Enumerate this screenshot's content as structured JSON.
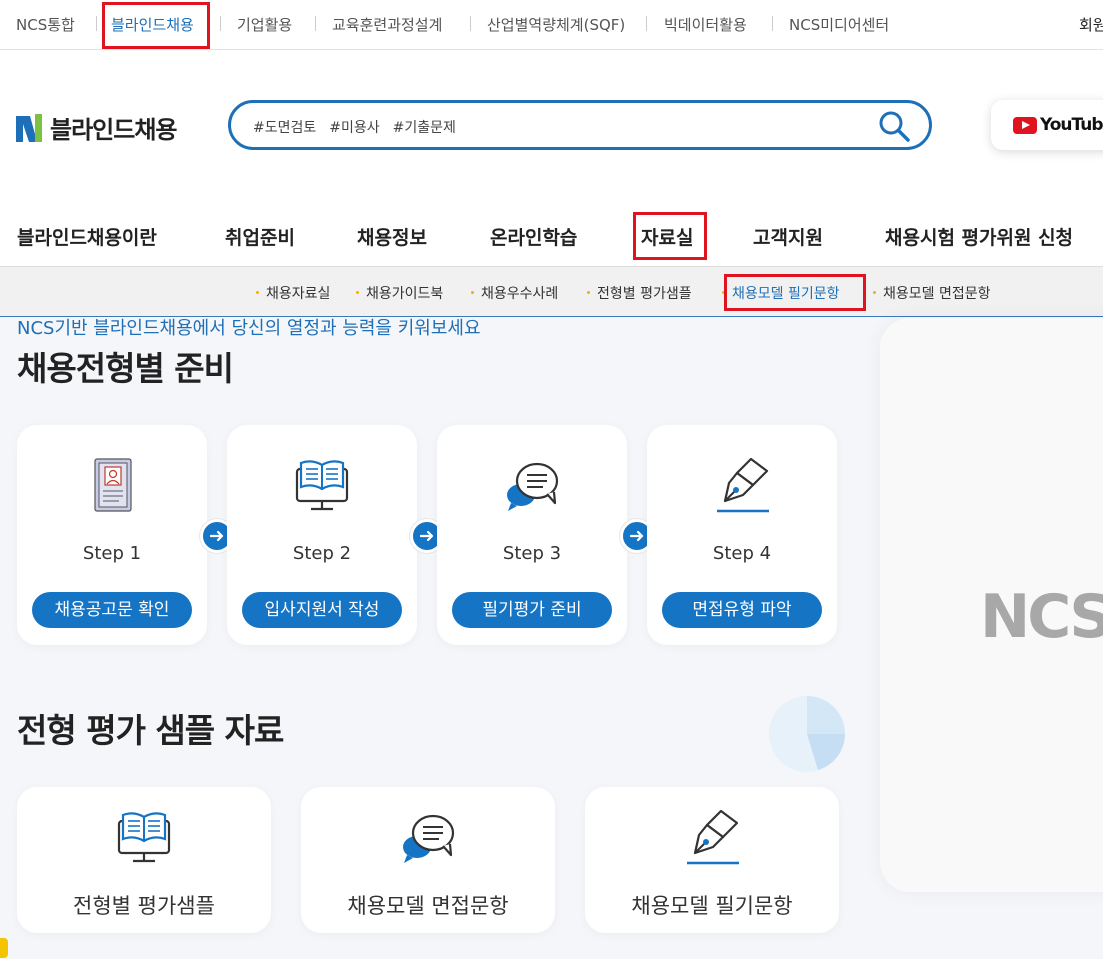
{
  "topbar": {
    "items": [
      "NCS통합",
      "블라인드채용",
      "기업활용",
      "교육훈련과정설계",
      "산업별역량체계(SQF)",
      "빅데이터활용",
      "NCS미디어센터"
    ],
    "right_link": "회원"
  },
  "header": {
    "logo_text": "블라인드채용",
    "search_tags": [
      "#도면검토",
      "#미용사",
      "#기출문제"
    ],
    "youtube_label": "YouTube"
  },
  "gnb": {
    "items": [
      "블라인드채용이란",
      "취업준비",
      "채용정보",
      "온라인학습",
      "자료실",
      "고객지원",
      "채용시험 평가위원 신청"
    ]
  },
  "subnav": {
    "items": [
      "채용자료실",
      "채용가이드북",
      "채용우수사례",
      "전형별 평가샘플",
      "채용모델 필기문항",
      "채용모델 면접문항"
    ]
  },
  "main": {
    "tagline": "NCS기반 블라인드채용에서 당신의 열정과 능력을 키워보세요",
    "section1_title": "채용전형별 준비",
    "steps": [
      {
        "label": "Step 1",
        "button": "채용공고문 확인",
        "icon": "id-card-icon"
      },
      {
        "label": "Step 2",
        "button": "입사지원서 작성",
        "icon": "book-monitor-icon"
      },
      {
        "label": "Step 3",
        "button": "필기평가 준비",
        "icon": "chat-bubble-icon"
      },
      {
        "label": "Step 4",
        "button": "면접유형 파악",
        "icon": "pen-nib-icon"
      }
    ],
    "section2_title": "전형 평가 샘플 자료",
    "samples": [
      {
        "label": "전형별 평가샘플",
        "icon": "book-monitor-icon"
      },
      {
        "label": "채용모델 면접문항",
        "icon": "chat-bubble-icon"
      },
      {
        "label": "채용모델 필기문항",
        "icon": "pen-nib-icon"
      }
    ],
    "watermark": "NCS"
  },
  "colors": {
    "accent": "#1574c4",
    "highlight_box": "#e0141e",
    "link_active": "#1d6fb8"
  }
}
